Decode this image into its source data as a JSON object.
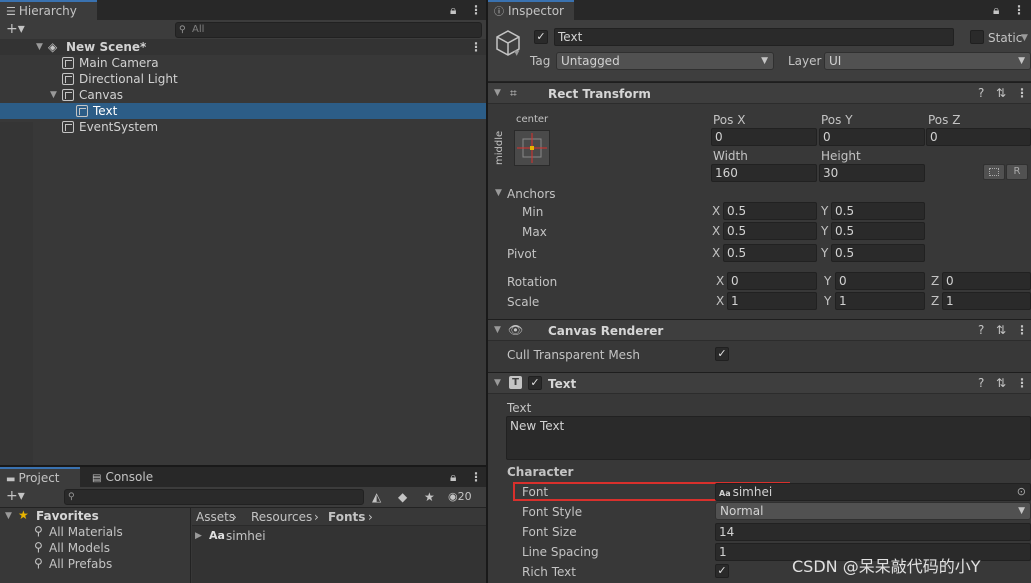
{
  "hierarchy": {
    "tab_label": "Hierarchy",
    "search_placeholder": "All",
    "add_label": "+▾",
    "items": [
      {
        "label": "New Scene*"
      },
      {
        "label": "Main Camera"
      },
      {
        "label": "Directional Light"
      },
      {
        "label": "Canvas"
      },
      {
        "label": "Text"
      },
      {
        "label": "EventSystem"
      }
    ]
  },
  "project": {
    "tab_label": "Project",
    "console_tab_label": "Console",
    "hidden_count": "20",
    "favorites_label": "Favorites",
    "favorites": [
      "All Materials",
      "All Models",
      "All Prefabs"
    ],
    "breadcrumb": [
      "Assets",
      "Resources",
      "Fonts"
    ],
    "asset_icon": "Aa",
    "asset_name": "simhei"
  },
  "inspector": {
    "tab_label": "Inspector",
    "object_name": "Text",
    "static_label": "Static",
    "tag_label": "Tag",
    "tag_value": "Untagged",
    "layer_label": "Layer",
    "layer_value": "UI",
    "rect_transform": {
      "title": "Rect Transform",
      "anchor_h": "center",
      "anchor_v": "middle",
      "posx_label": "Pos X",
      "posx": "0",
      "posy_label": "Pos Y",
      "posy": "0",
      "posz_label": "Pos Z",
      "posz": "0",
      "width_label": "Width",
      "width": "160",
      "height_label": "Height",
      "height": "30",
      "r_label": "R",
      "anchors_label": "Anchors",
      "min_label": "Min",
      "min_x": "0.5",
      "min_y": "0.5",
      "max_label": "Max",
      "max_x": "0.5",
      "max_y": "0.5",
      "pivot_label": "Pivot",
      "pivot_x": "0.5",
      "pivot_y": "0.5",
      "rotation_label": "Rotation",
      "rot_x": "0",
      "rot_y": "0",
      "rot_z": "0",
      "scale_label": "Scale",
      "scale_x": "1",
      "scale_y": "1",
      "scale_z": "1",
      "x": "X",
      "y": "Y",
      "z": "Z"
    },
    "canvas_renderer": {
      "title": "Canvas Renderer",
      "cull_label": "Cull Transparent Mesh"
    },
    "text_component": {
      "title": "Text",
      "text_label": "Text",
      "text_value": "New Text",
      "character_label": "Character",
      "font_label": "Font",
      "font_icon": "Aa",
      "font_value": "simhei",
      "font_style_label": "Font Style",
      "font_style_value": "Normal",
      "font_size_label": "Font Size",
      "font_size_value": "14",
      "line_spacing_label": "Line Spacing",
      "line_spacing_value": "1",
      "rich_text_label": "Rich Text"
    }
  },
  "watermark": "CSDN @呆呆敲代码的小Y",
  "colors": {
    "selection": "#2c5d87",
    "highlight_box": "#d9302c",
    "accent_tab": "#3a72b0"
  }
}
